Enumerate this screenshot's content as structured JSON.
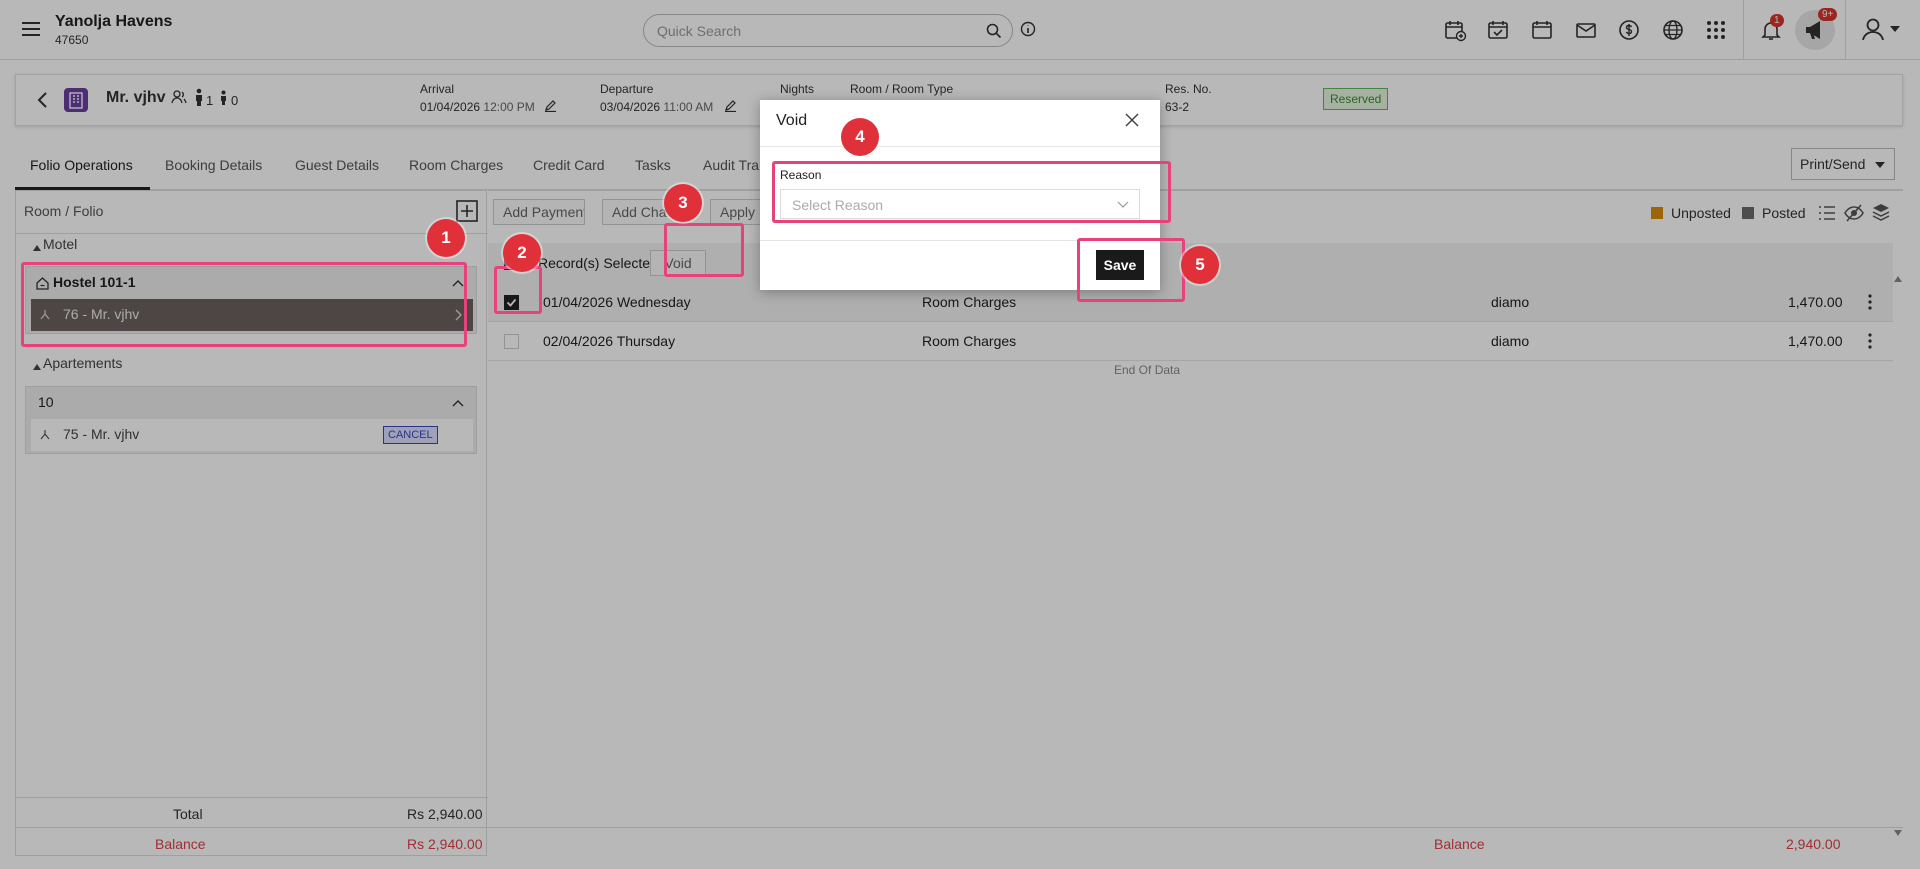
{
  "header": {
    "hotel_name": "Yanolja Havens",
    "hotel_id": "47650",
    "search_placeholder": "Quick Search",
    "notification_count": "1",
    "announcement_count": "9+"
  },
  "reservation": {
    "guest_name": "Mr. vjhv",
    "adults": "1",
    "children": "0",
    "arrival_label": "Arrival",
    "arrival_date": "01/04/2026",
    "arrival_time": "12:00 PM",
    "departure_label": "Departure",
    "departure_date": "03/04/2026",
    "departure_time": "11:00 AM",
    "nights_label": "Nights",
    "room_type_label": "Room / Room Type",
    "res_no_label": "Res. No.",
    "res_no": "63-2",
    "status": "Reserved"
  },
  "tabs": [
    {
      "label": "Folio Operations"
    },
    {
      "label": "Booking Details"
    },
    {
      "label": "Guest Details"
    },
    {
      "label": "Room Charges"
    },
    {
      "label": "Credit Card"
    },
    {
      "label": "Tasks"
    },
    {
      "label": "Audit Tra"
    }
  ],
  "print_send_label": "Print/Send",
  "left_panel": {
    "title": "Room / Folio",
    "groups": [
      {
        "name": "Motel",
        "room": "Hostel 101-1",
        "folio": "76 - Mr. vjhv"
      },
      {
        "name": "Apartements",
        "room": "10",
        "folio": "75 - Mr. vjhv",
        "folio_badge": "CANCEL"
      }
    ],
    "total_label": "Total",
    "total_value": "Rs 2,940.00",
    "balance_label": "Balance",
    "balance_value": "Rs 2,940.00"
  },
  "toolbar": {
    "add_payment": "Add Payment",
    "add_charge": "Add Cha",
    "apply": "Apply D",
    "void": "Void"
  },
  "legend": {
    "unposted": "Unposted",
    "posted": "Posted",
    "unposted_color": "#d98c0a",
    "posted_color": "#6b6b6b"
  },
  "selection": {
    "text": "Record(s) Selected"
  },
  "rows": [
    {
      "date": "01/04/2026 Wednesday",
      "description": "Room Charges",
      "user": "diamo",
      "amount": "1,470.00",
      "checked": true
    },
    {
      "date": "02/04/2026 Thursday",
      "description": "Room Charges",
      "user": "diamo",
      "amount": "1,470.00",
      "checked": false
    }
  ],
  "end_of_data": "End Of Data",
  "footer": {
    "balance_label": "Balance",
    "balance_value": "2,940.00"
  },
  "modal": {
    "title": "Void",
    "reason_label": "Reason",
    "reason_placeholder": "Select Reason",
    "save_label": "Save"
  },
  "annotations": [
    "1",
    "2",
    "3",
    "4",
    "5"
  ],
  "colors": {
    "accent": "#e8427c",
    "marker": "#e0313b",
    "negative": "#e0414a",
    "selected_folio": "#6d6260"
  }
}
